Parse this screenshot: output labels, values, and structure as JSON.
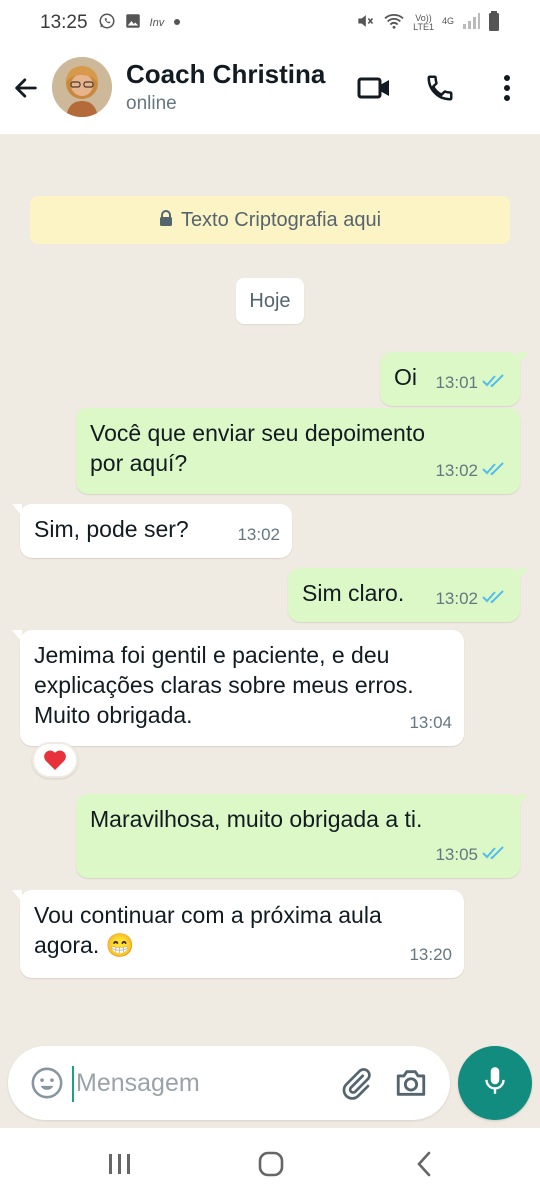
{
  "status_bar": {
    "time": "13:25",
    "carrier_small": "Inv",
    "volte_top": "Vo))",
    "volte_bottom": "LTE1",
    "network": "4G",
    "icons": [
      "whatsapp-icon",
      "gallery-icon",
      "dot-icon",
      "mute-icon",
      "wifi-icon",
      "signal-icon",
      "battery-icon"
    ]
  },
  "header": {
    "contact_name": "Coach Christina",
    "contact_status": "online",
    "icons": [
      "back-arrow-icon",
      "avatar",
      "video-call-icon",
      "phone-icon",
      "more-vert-icon"
    ]
  },
  "chat": {
    "encryption_banner": "Texto Criptografia aqui",
    "date_chip": "Hoje",
    "messages": [
      {
        "direction": "out",
        "text": "Oi",
        "time": "13:01",
        "read": true
      },
      {
        "direction": "out",
        "text": "Você que enviar seu depoimento por aquí?",
        "time": "13:02",
        "read": true
      },
      {
        "direction": "in",
        "text": "Sim, pode ser?",
        "time": "13:02"
      },
      {
        "direction": "out",
        "text": "Sim claro.",
        "time": "13:02",
        "read": true
      },
      {
        "direction": "in",
        "text": "Jemima foi gentil e paciente, e deu explicações claras sobre meus erros. Muito obrigada.",
        "time": "13:04",
        "reaction": "❤️"
      },
      {
        "direction": "out",
        "text": "Maravilhosa, muito obrigada a ti.",
        "time": "13:05",
        "read": true
      },
      {
        "direction": "in",
        "text": "Vou continuar com a próxima aula agora.",
        "emoji": "😁",
        "time": "13:20"
      }
    ]
  },
  "input_bar": {
    "placeholder": "Mensagem",
    "icons": [
      "emoji-icon",
      "attach-icon",
      "camera-icon",
      "mic-icon"
    ]
  },
  "nav_bar": {
    "icons": [
      "recent-apps-icon",
      "home-icon",
      "back-icon"
    ]
  },
  "colors": {
    "chat_bg": "#efeae2",
    "outgoing_bubble": "#dcf8c6",
    "incoming_bubble": "#ffffff",
    "banner_bg": "#fdf4c5",
    "read_ticks": "#53bdeb",
    "accent": "#128c7e"
  }
}
